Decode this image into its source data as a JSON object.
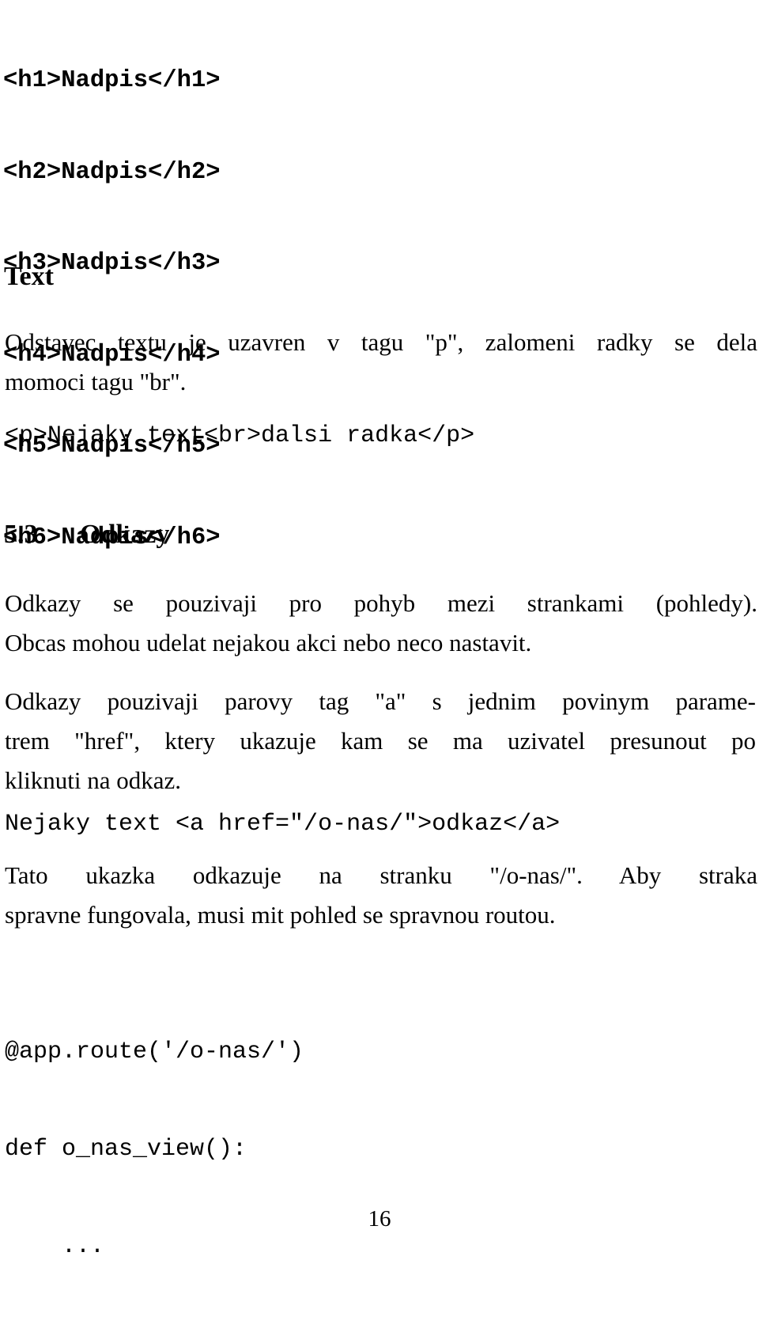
{
  "document": {
    "page_number": "16",
    "language": "cs"
  },
  "code_headings": {
    "lines": [
      "<h1>Nadpis</h1>",
      "<h2>Nadpis</h2>",
      "<h3>Nadpis</h3>",
      "<h4>Nadpis</h4>",
      "<h5>Nadpis</h5>",
      "<h6>Nadpis</h6>"
    ]
  },
  "section_text": {
    "heading": "Text",
    "paragraph_line_1": "Odstavec textu je uzavren v tagu \"p\", zalomeni radky se dela",
    "paragraph_line_2": "momoci tagu \"br\".",
    "code": "<p>Nejaky text<br>dalsi radka</p>"
  },
  "section_odkazy": {
    "number": "5.3",
    "title": "Odkazy",
    "paragraph_1_line_1": "Odkazy se pouzivaji pro pohyb mezi strankami (pohledy).",
    "paragraph_1_line_2": "Obcas mohou udelat nejakou akci nebo neco nastavit.",
    "paragraph_2_line_1": "Odkazy pouzivaji parovy tag \"a\" s jednim povinym parame-",
    "paragraph_2_line_2": "trem \"href\", ktery ukazuje kam se ma uzivatel presunout po",
    "paragraph_2_line_3": "kliknuti na odkaz.",
    "code_anchor": "Nejaky text <a href=\"/o-nas/\">odkaz</a>",
    "paragraph_3_line_1": "Tato ukazka odkazuje na stranku \"/o-nas/\".  Aby straka",
    "paragraph_3_line_2": "spravne fungovala, musi mit pohled se spravnou routou.",
    "code_route_line_1": "@app.route('/o-nas/')",
    "code_route_line_2": "def o_nas_view():",
    "code_route_line_3": "    ..."
  }
}
